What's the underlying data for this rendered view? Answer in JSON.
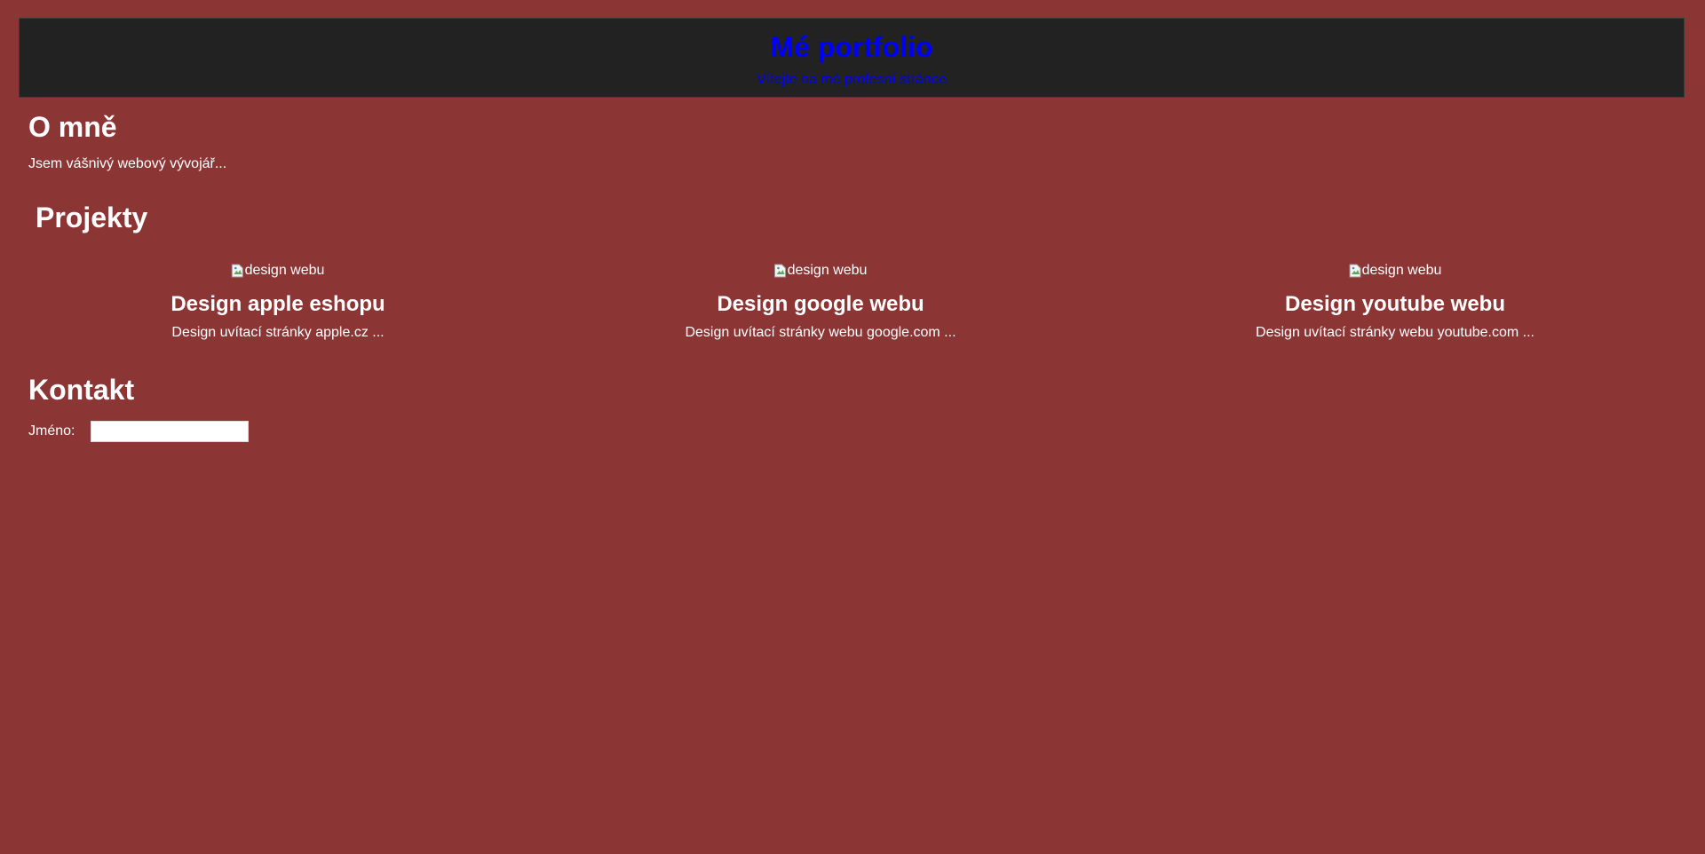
{
  "colors": {
    "background": "#8c3535",
    "header_background": "#222222",
    "header_text": "#0000ff",
    "body_text": "#ffffff"
  },
  "header": {
    "title": "Mé portfolio",
    "subtitle": "Vítejte na mé profesní stránce"
  },
  "about": {
    "title": "O mně",
    "text": "Jsem vášnivý webový vývojář..."
  },
  "projects": {
    "title": "Projekty",
    "items": [
      {
        "image_alt": "design webu",
        "image_icon": "broken-image-icon",
        "title": "Design apple eshopu",
        "description": "Design uvítací stránky apple.cz ..."
      },
      {
        "image_alt": "design webu",
        "image_icon": "broken-image-icon",
        "title": "Design google webu",
        "description": "Design uvítací stránky webu google.com ..."
      },
      {
        "image_alt": "design webu",
        "image_icon": "broken-image-icon",
        "title": "Design youtube webu",
        "description": "Design uvítací stránky webu youtube.com ..."
      }
    ]
  },
  "contact": {
    "title": "Kontakt",
    "name_label": "Jméno:",
    "name_value": ""
  }
}
